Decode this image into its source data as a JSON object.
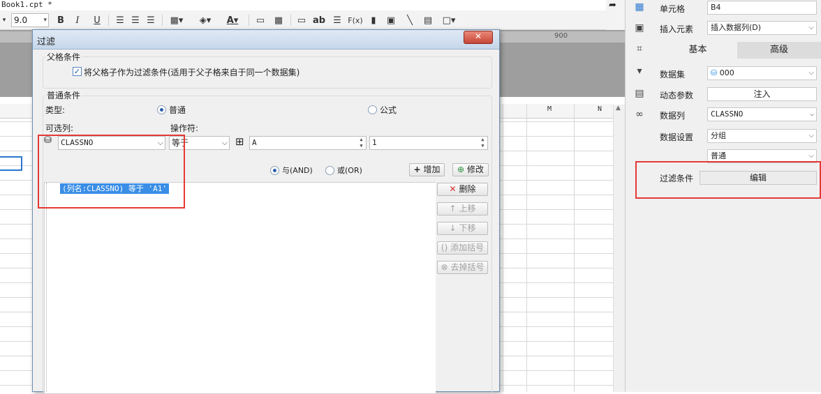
{
  "designer": {
    "file_tab": "Book1.cpt *",
    "font_size": "9.0",
    "toolbar": {
      "bold": "B",
      "italic": "I",
      "underline": "U",
      "text_ab": "ab",
      "formula": "F(x)"
    },
    "ruler_labels": [
      "900"
    ],
    "columns": [
      "M",
      "N"
    ]
  },
  "props": {
    "cell_label": "单元格",
    "cell_value": "B4",
    "insert_label": "插入元素",
    "insert_value": "插入数据列(D)",
    "tab_basic": "基本",
    "tab_advanced": "高级",
    "dataset_label": "数据集",
    "dataset_value": "000",
    "dynparam_label": "动态参数",
    "dynparam_button": "注入",
    "datacol_label": "数据列",
    "datacol_value": "CLASSNO",
    "dataset_setting_label": "数据设置",
    "dataset_setting_value": "分组",
    "mode_value": "普通",
    "filter_label": "过滤条件",
    "filter_button": "编辑"
  },
  "dialog": {
    "title": "过滤",
    "close": "✕",
    "parent_group": "父格条件",
    "parent_checkbox": "将父格子作为过滤条件(适用于父子格来自于同一个数据集)",
    "normal_group": "普通条件",
    "type_label": "类型:",
    "type_normal": "普通",
    "type_formula": "公式",
    "column_label": "可选列:",
    "operator_label": "操作符:",
    "column_value": "CLASSNO",
    "operator_value": "等于",
    "value_field": "A",
    "value_field2": "1",
    "and_label": "与(AND)",
    "or_label": "或(OR)",
    "add_button": "增加",
    "modify_button": "修改",
    "conditions": [
      "(列名:CLASSNO) 等于 'A1'"
    ],
    "delete_button": "删除",
    "up_button": "上移",
    "down_button": "下移",
    "add_bracket_button": "添加括号",
    "remove_bracket_button": "去掉括号"
  }
}
